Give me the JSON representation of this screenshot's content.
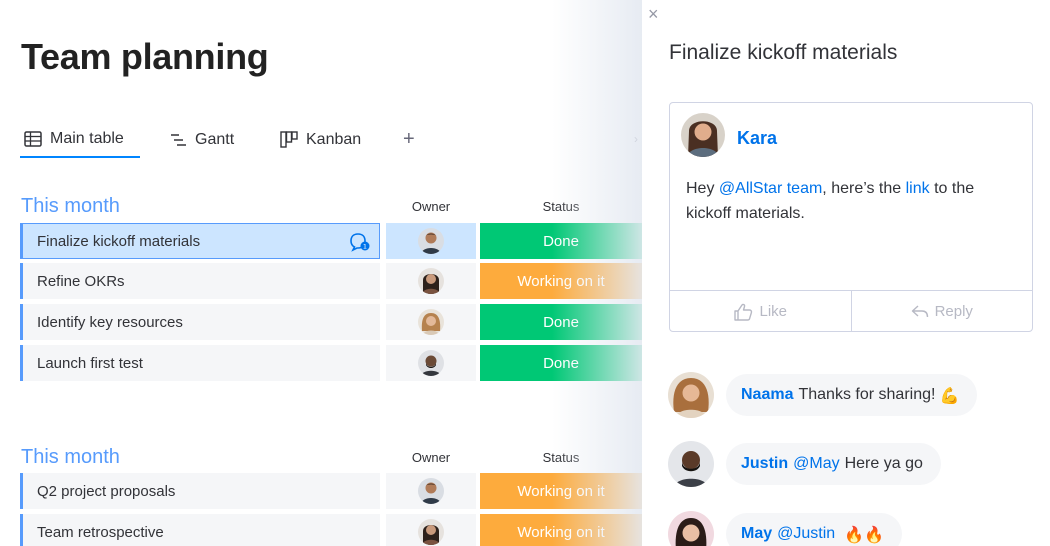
{
  "board": {
    "title": "Team planning",
    "views": [
      {
        "label": "Main table",
        "icon": "table-icon"
      },
      {
        "label": "Gantt",
        "icon": "gantt-icon"
      },
      {
        "label": "Kanban",
        "icon": "kanban-icon"
      }
    ],
    "add_view": "+",
    "more_views": "›",
    "columns": {
      "owner": "Owner",
      "status": "Status"
    },
    "groups": [
      {
        "title": "This month",
        "rows": [
          {
            "name": "Finalize kickoff materials",
            "status": "Done"
          },
          {
            "name": "Refine OKRs",
            "status": "Working on it"
          },
          {
            "name": "Identify key resources",
            "status": "Done"
          },
          {
            "name": "Launch first test",
            "status": "Done"
          }
        ]
      },
      {
        "title": "This month",
        "rows": [
          {
            "name": "Q2 project proposals",
            "status": "Working on it"
          },
          {
            "name": "Team retrospective",
            "status": "Working on it"
          }
        ]
      }
    ],
    "status_colors": {
      "Done": "#00c875",
      "Working on it": "#fdab3d"
    },
    "accent": "#579bfc"
  },
  "panel": {
    "close": "×",
    "title": "Finalize kickoff materials",
    "update": {
      "author": "Kara",
      "text_before": "Hey",
      "mention": "@AllStar team",
      "text_middle": ", here’s the",
      "link": "link",
      "text_after": "to the kickoff materials.",
      "like": "Like",
      "reply": "Reply"
    },
    "replies": [
      {
        "author": "Naama",
        "mention": "",
        "text": "Thanks for sharing!",
        "emoji": "💪"
      },
      {
        "author": "Justin",
        "mention": "@May",
        "text": "Here ya go",
        "emoji": ""
      },
      {
        "author": "May",
        "mention": "@Justin",
        "text": "",
        "emoji": "🔥🔥"
      }
    ]
  }
}
